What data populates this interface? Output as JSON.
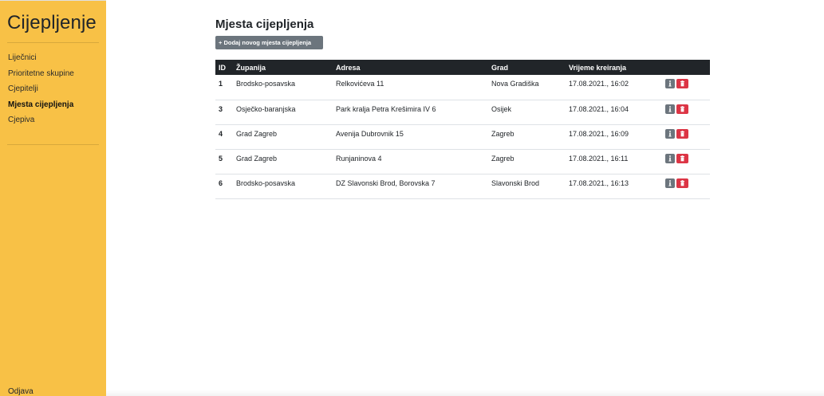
{
  "sidebar": {
    "brand": "Cijepljenje",
    "items": [
      {
        "label": "Liječnici",
        "active": false
      },
      {
        "label": "Prioritetne skupine",
        "active": false
      },
      {
        "label": "Cjepitelji",
        "active": false
      },
      {
        "label": "Mjesta cijepljenja",
        "active": true
      },
      {
        "label": "Cjepiva",
        "active": false
      }
    ],
    "logout": "Odjava"
  },
  "main": {
    "title": "Mjesta cijepljenja",
    "add_button": "+ Dodaj novog mjesta cijepljenja"
  },
  "table": {
    "headers": [
      "ID",
      "Županija",
      "Adresa",
      "Grad",
      "Vrijeme kreiranja"
    ],
    "rows": [
      [
        "1",
        "Brodsko-posavska",
        "Relkovićeva 11",
        "Nova Gradiška",
        "17.08.2021., 16:02"
      ],
      [
        "3",
        "Osječko-baranjska",
        "Park kralja Petra Krešimira IV 6",
        "Osijek",
        "17.08.2021., 16:04"
      ],
      [
        "4",
        "Grad Zagreb",
        "Avenija Dubrovnik 15",
        "Zagreb",
        "17.08.2021., 16:09"
      ],
      [
        "5",
        "Grad Zagreb",
        "Runjaninova 4",
        "Zagreb",
        "17.08.2021., 16:11"
      ],
      [
        "6",
        "Brodsko-posavska",
        "DZ Slavonski Brod, Borovska 7",
        "Slavonski Brod",
        "17.08.2021., 16:13"
      ]
    ],
    "row_actions": [
      "info-icon",
      "trash-icon"
    ]
  },
  "colors": {
    "sidebar_bg": "#f8c146",
    "header_bg": "#212529",
    "secondary": "#6c757d",
    "danger": "#dc3545"
  }
}
